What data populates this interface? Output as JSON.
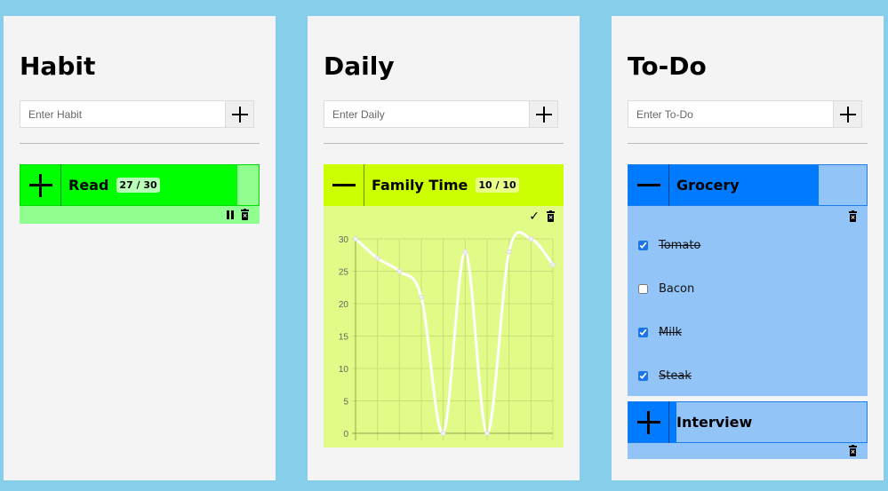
{
  "habit": {
    "title": "Habit",
    "input_placeholder": "Enter Habit",
    "cards": [
      {
        "name": "Read",
        "progress_text": "27 / 30",
        "progress": 0.9,
        "color": "#00ff00"
      }
    ]
  },
  "daily": {
    "title": "Daily",
    "input_placeholder": "Enter Daily",
    "cards": [
      {
        "name": "Family Time",
        "progress_text": "10 / 10",
        "progress": 1.0,
        "color": "#ccff00"
      }
    ]
  },
  "todo": {
    "title": "To-Do",
    "input_placeholder": "Enter To-Do",
    "cards": [
      {
        "name": "Grocery",
        "progress": 0.75,
        "color": "#007bff",
        "items": [
          {
            "label": "Tomato",
            "checked": true
          },
          {
            "label": "Bacon",
            "checked": false
          },
          {
            "label": "Milk",
            "checked": true
          },
          {
            "label": "Steak",
            "checked": true
          }
        ]
      },
      {
        "name": "Interview",
        "progress": 0.05,
        "color": "#007bff",
        "items": []
      }
    ]
  },
  "chart_data": {
    "type": "line",
    "x": [
      1,
      2,
      3,
      4,
      5,
      6,
      7,
      8,
      9,
      10
    ],
    "values": [
      30,
      27,
      25,
      21,
      0,
      28,
      0,
      28,
      30,
      26
    ],
    "ylim": [
      0,
      30
    ],
    "yticks": [
      "0",
      "5",
      "10",
      "15",
      "20",
      "25",
      "30"
    ],
    "grid": true,
    "line_color": "#ffffff",
    "background": "#e2fa87"
  }
}
